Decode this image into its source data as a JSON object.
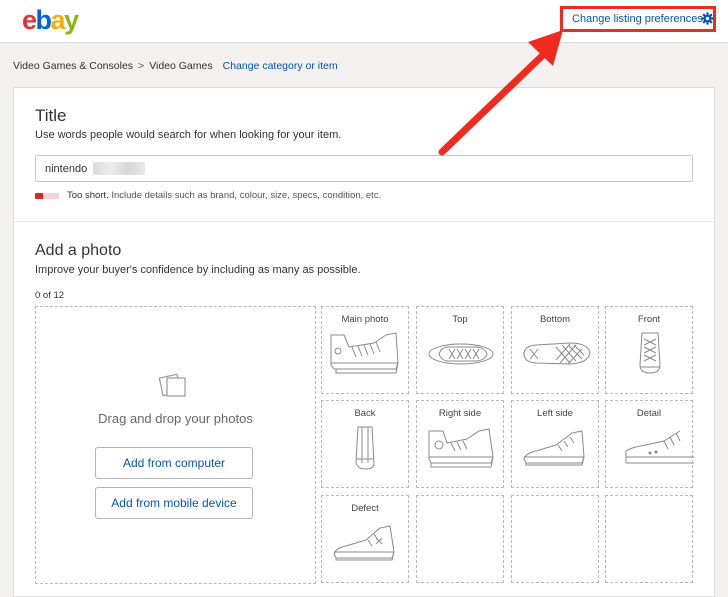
{
  "header": {
    "logo": {
      "e": "e",
      "b": "b",
      "a": "a",
      "y": "y"
    },
    "prefs_label": "Change listing preferences",
    "prefs_icon": "gear-icon"
  },
  "breadcrumb": {
    "level1": "Video Games & Consoles",
    "level2": "Video Games",
    "separator": ">",
    "change_link": "Change category or item"
  },
  "title_section": {
    "heading": "Title",
    "subtitle": "Use words people would search for when looking for your item.",
    "input_value": "nintendo",
    "meter_status": "Too short.",
    "meter_hint": "Include details such as brand, colour, size, specs, condition, etc.",
    "meter_level": 0.33
  },
  "photo_section": {
    "heading": "Add a photo",
    "subtitle": "Improve your buyer's confidence by including as many as possible.",
    "count": "0 of 12",
    "drop_text": "Drag and drop your photos",
    "btn_computer": "Add from computer",
    "btn_mobile": "Add from mobile device",
    "slots": [
      "Main photo",
      "Top",
      "Bottom",
      "Front",
      "Back",
      "Right side",
      "Left side",
      "Detail",
      "Defect",
      "",
      "",
      ""
    ]
  },
  "colors": {
    "link": "#0654ba",
    "highlight": "#ee2b1e",
    "meter_red": "#e0262c"
  }
}
